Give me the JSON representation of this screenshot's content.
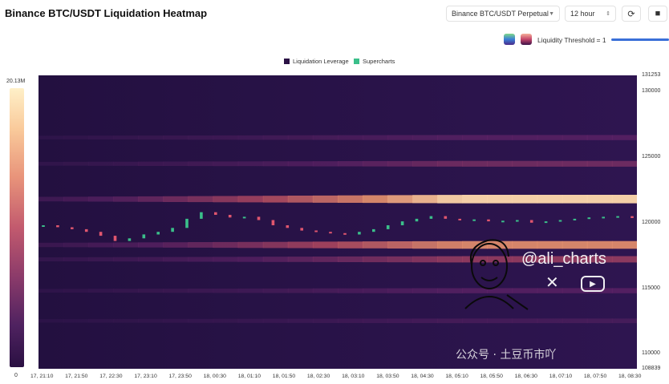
{
  "header": {
    "title": "Binance BTC/USDT Liquidation Heatmap",
    "pair_select": "Binance BTC/USDT Perpetual",
    "range_select": "12 hour"
  },
  "threshold": {
    "label": "Liquidity Threshold = 1"
  },
  "legend": {
    "items": [
      "Liquidation Leverage",
      "Supercharts"
    ],
    "colors": [
      "#2b1245",
      "#3bbf8a"
    ]
  },
  "colorscale": {
    "max_label": "20.13M",
    "min_label": "0"
  },
  "watermark": {
    "handle": "@ali_charts",
    "footer": "公众号 · 土豆币市吖"
  },
  "chart_data": {
    "type": "heatmap",
    "title": "Binance BTC/USDT Liquidation Heatmap",
    "y_ticks": [
      "131253",
      "130000",
      "125000",
      "120000",
      "115000",
      "110000",
      "108839"
    ],
    "ylim": [
      108839,
      131253
    ],
    "x_ticks": [
      "17, 21:10",
      "17, 21:50",
      "17, 22:30",
      "17, 23:10",
      "17, 23:50",
      "18, 00:30",
      "18, 01:10",
      "18, 01:50",
      "18, 02:30",
      "18, 03:10",
      "18, 03:50",
      "18, 04:30",
      "18, 05:10",
      "18, 05:50",
      "18, 06:30",
      "18, 07:10",
      "18, 07:50",
      "18, 08:30"
    ],
    "price_series": [
      119800,
      119650,
      119500,
      119300,
      119000,
      118600,
      118800,
      119100,
      119300,
      119600,
      120300,
      120800,
      120600,
      120400,
      120450,
      120200,
      119800,
      119600,
      119400,
      119300,
      119200,
      119100,
      119300,
      119500,
      119800,
      120100,
      120300,
      120500,
      120300,
      120200,
      120250,
      120100,
      120150,
      120200,
      120000,
      120100,
      120200,
      120300,
      120400,
      120450,
      120500,
      120350
    ],
    "bands": [
      {
        "price": 121800,
        "intensity": 0.95
      },
      {
        "price": 118300,
        "intensity": 0.8
      },
      {
        "price": 117200,
        "intensity": 0.55
      },
      {
        "price": 124500,
        "intensity": 0.45
      },
      {
        "price": 126500,
        "intensity": 0.35
      },
      {
        "price": 114800,
        "intensity": 0.35
      },
      {
        "price": 112500,
        "intensity": 0.25
      }
    ]
  }
}
